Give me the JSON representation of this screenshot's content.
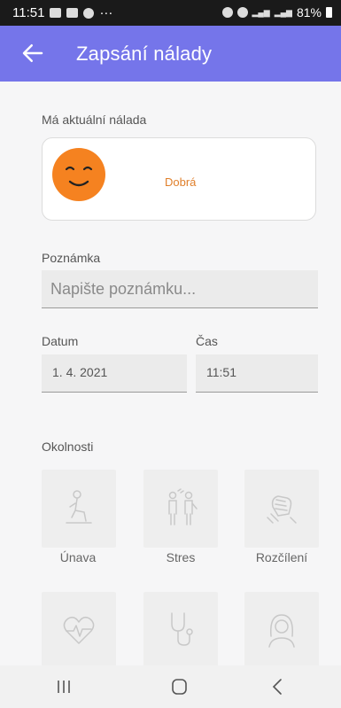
{
  "status": {
    "time": "11:51",
    "more": "···",
    "battery": "81%"
  },
  "appbar": {
    "title": "Zapsání nálady"
  },
  "mood": {
    "label": "Má aktuální nálada",
    "value": "Dobrá",
    "color": "#f58220"
  },
  "note": {
    "label": "Poznámka",
    "placeholder": "Napište poznámku..."
  },
  "date": {
    "label": "Datum",
    "value": "1. 4. 2021"
  },
  "time": {
    "label": "Čas",
    "value": "11:51"
  },
  "circumstances": {
    "label": "Okolnosti",
    "items": [
      {
        "label": "Únava",
        "icon": "tired-person-icon"
      },
      {
        "label": "Stres",
        "icon": "stress-people-icon"
      },
      {
        "label": "Rozčílení",
        "icon": "angry-fist-icon"
      },
      {
        "label": "",
        "icon": "heart-pulse-icon"
      },
      {
        "label": "",
        "icon": "stethoscope-icon"
      },
      {
        "label": "",
        "icon": "woman-icon"
      }
    ]
  },
  "colors": {
    "accent": "#7575ea",
    "mood_text": "#e07f2a",
    "tile_bg": "#eeeeee"
  }
}
